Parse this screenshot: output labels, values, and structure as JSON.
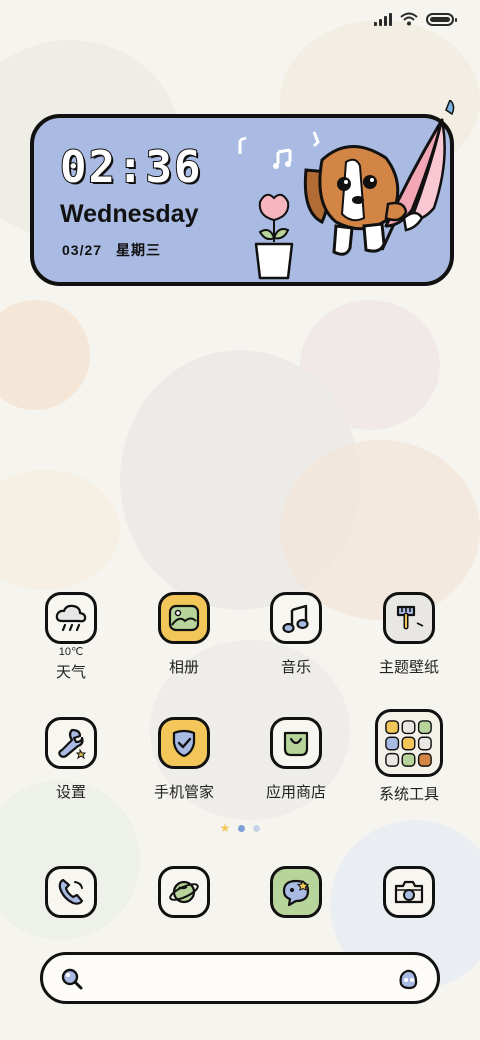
{
  "status_bar": {
    "signal_icon": "signal-icon",
    "wifi_icon": "wifi-icon",
    "battery_icon": "battery-icon"
  },
  "clock": {
    "time": "02:36",
    "day": "Wednesday",
    "date": "03/27",
    "weekday_cn": "星期三"
  },
  "apps": {
    "weather": {
      "label": "天气",
      "temp": "10℃",
      "icon": "cloud-rain-icon"
    },
    "gallery": {
      "label": "相册",
      "icon": "picture-icon"
    },
    "music": {
      "label": "音乐",
      "icon": "music-note-icon"
    },
    "themes": {
      "label": "主题壁纸",
      "icon": "paint-brush-icon"
    },
    "settings": {
      "label": "设置",
      "icon": "wrench-icon"
    },
    "security": {
      "label": "手机管家",
      "icon": "shield-check-icon"
    },
    "store": {
      "label": "应用商店",
      "icon": "shopping-bag-icon"
    },
    "tools": {
      "label": "系统工具",
      "icon": "folder-grid-icon"
    }
  },
  "dock": [
    "phone-icon",
    "browser-planet-icon",
    "messages-icon",
    "camera-icon"
  ],
  "page_indicator": {
    "count": 3,
    "active_index": 1
  },
  "colors": {
    "widget_bg": "#a9bbe2",
    "outline": "#111111",
    "accent_blue": "#7f9fd6",
    "accent_green": "#b7d49a",
    "accent_yellow": "#f2c659"
  }
}
